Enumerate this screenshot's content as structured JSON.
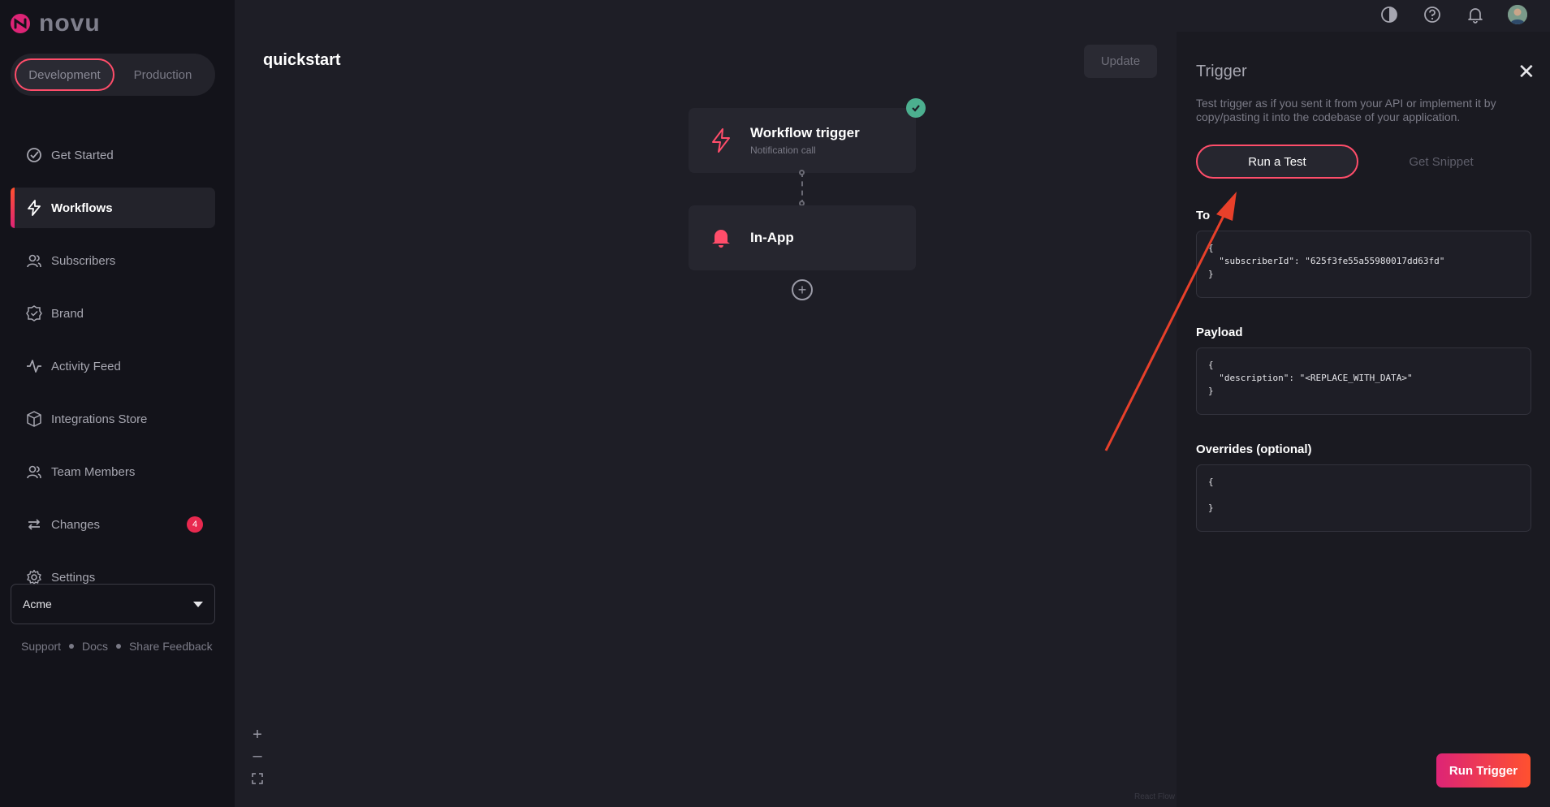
{
  "app": {
    "brand": "novu"
  },
  "environment": {
    "options": [
      "Development",
      "Production"
    ],
    "selected": "Development"
  },
  "sidebar": {
    "items": [
      {
        "label": "Get Started",
        "icon": "check-circle-icon"
      },
      {
        "label": "Workflows",
        "icon": "bolt-icon",
        "active": true
      },
      {
        "label": "Subscribers",
        "icon": "users-icon"
      },
      {
        "label": "Brand",
        "icon": "brand-badge-icon"
      },
      {
        "label": "Activity Feed",
        "icon": "activity-icon"
      },
      {
        "label": "Integrations Store",
        "icon": "box-icon"
      },
      {
        "label": "Team Members",
        "icon": "team-icon"
      },
      {
        "label": "Changes",
        "icon": "sync-icon",
        "badge": "4"
      },
      {
        "label": "Settings",
        "icon": "gear-icon"
      }
    ],
    "organization": "Acme",
    "footer": [
      "Support",
      "Docs",
      "Share Feedback"
    ]
  },
  "workflow": {
    "title": "quickstart",
    "update_label": "Update",
    "nodes": [
      {
        "title": "Workflow trigger",
        "subtitle": "Notification call",
        "icon": "bolt-icon"
      },
      {
        "title": "In-App",
        "icon": "bell-icon"
      }
    ],
    "watermark": "React Flow"
  },
  "trigger_panel": {
    "title": "Trigger",
    "description": "Test trigger as if you sent it from your API or implement it by copy/pasting it into the codebase of your application.",
    "tabs": [
      "Run a Test",
      "Get Snippet"
    ],
    "active_tab": "Run a Test",
    "to_label": "To",
    "to_value": "{\n  \"subscriberId\": \"625f3fe55a55980017dd63fd\"\n}",
    "payload_label": "Payload",
    "payload_value": "{\n  \"description\": \"<REPLACE_WITH_DATA>\"\n}",
    "overrides_label": "Overrides (optional)",
    "overrides_value": "{\n\n}",
    "run_label": "Run Trigger"
  },
  "colors": {
    "accent": "#ff4d6a",
    "gradient_start": "#dd2476",
    "gradient_end": "#ff512f",
    "success": "#4caf8f"
  }
}
